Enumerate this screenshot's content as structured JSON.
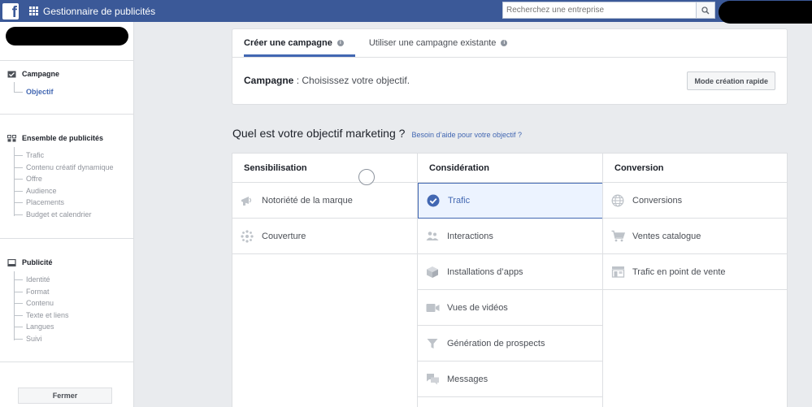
{
  "topbar": {
    "app_title": "Gestionnaire de publicités",
    "search_placeholder": "Recherchez une entreprise"
  },
  "leftnav": {
    "sections": [
      {
        "title": "Campagne",
        "icon": "checkbox-icon",
        "items": [
          {
            "label": "Objectif",
            "active": true
          }
        ]
      },
      {
        "title": "Ensemble de publicités",
        "icon": "adset-grid-icon",
        "items": [
          {
            "label": "Trafic"
          },
          {
            "label": "Contenu créatif dynamique"
          },
          {
            "label": "Offre"
          },
          {
            "label": "Audience"
          },
          {
            "label": "Placements"
          },
          {
            "label": "Budget et calendrier"
          }
        ]
      },
      {
        "title": "Publicité",
        "icon": "ad-square-icon",
        "items": [
          {
            "label": "Identité"
          },
          {
            "label": "Format"
          },
          {
            "label": "Contenu"
          },
          {
            "label": "Texte et liens"
          },
          {
            "label": "Langues"
          },
          {
            "label": "Suivi"
          }
        ]
      }
    ],
    "close_label": "Fermer"
  },
  "main": {
    "tabs": [
      {
        "label": "Créer une campagne",
        "active": true
      },
      {
        "label": "Utiliser une campagne existante",
        "active": false
      }
    ],
    "campaign_label": "Campagne",
    "campaign_text": " : Choisissez votre objectif.",
    "quick_mode_label": "Mode création rapide",
    "question": "Quel est votre objectif marketing ?",
    "help_link": "Besoin d’aide pour votre objectif ?",
    "columns": [
      {
        "title": "Sensibilisation",
        "objectives": [
          {
            "label": "Notoriété de la marque",
            "icon": "megaphone-icon"
          },
          {
            "label": "Couverture",
            "icon": "reach-icon"
          }
        ]
      },
      {
        "title": "Considération",
        "objectives": [
          {
            "label": "Trafic",
            "icon": "check-circle-icon",
            "selected": true
          },
          {
            "label": "Interactions",
            "icon": "people-icon"
          },
          {
            "label": "Installations d’apps",
            "icon": "cube-icon"
          },
          {
            "label": "Vues de vidéos",
            "icon": "video-icon"
          },
          {
            "label": "Génération de prospects",
            "icon": "funnel-icon"
          },
          {
            "label": "Messages",
            "icon": "chat-icon"
          }
        ]
      },
      {
        "title": "Conversion",
        "objectives": [
          {
            "label": "Conversions",
            "icon": "globe-icon"
          },
          {
            "label": "Ventes catalogue",
            "icon": "cart-icon"
          },
          {
            "label": "Trafic en point de vente",
            "icon": "store-icon"
          }
        ]
      }
    ]
  },
  "colors": {
    "topbar": "#3b5998",
    "accent": "#4267b2",
    "selected_bg": "#ecf3ff"
  }
}
